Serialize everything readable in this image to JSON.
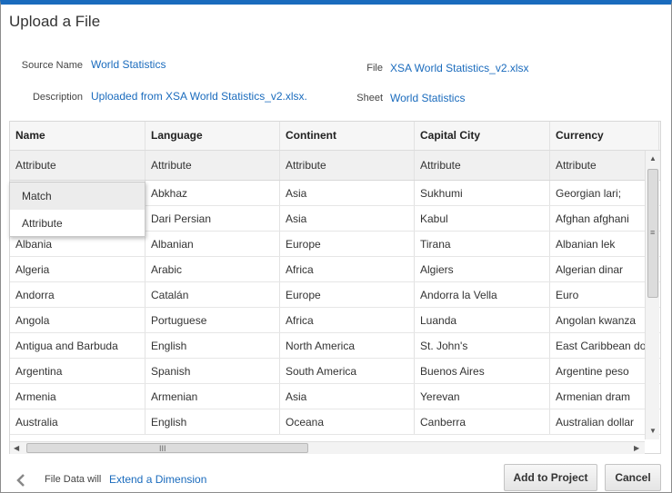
{
  "dialog": {
    "title": "Upload a File"
  },
  "meta": {
    "source_name_label": "Source Name",
    "source_name_value": "World Statistics",
    "description_label": "Description",
    "description_value": "Uploaded from XSA World Statistics_v2.xlsx.",
    "file_label": "File",
    "file_value": "XSA World Statistics_v2.xlsx",
    "sheet_label": "Sheet",
    "sheet_value": "World Statistics"
  },
  "table": {
    "columns": [
      "Name",
      "Language",
      "Continent",
      "Capital City",
      "Currency"
    ],
    "types": [
      "Attribute",
      "Attribute",
      "Attribute",
      "Attribute",
      "Attribute"
    ],
    "rows": [
      [
        "",
        "Abkhaz",
        "Asia",
        "Sukhumi",
        "Georgian lari;"
      ],
      [
        "",
        "Dari Persian",
        "Asia",
        "Kabul",
        "Afghan afghani"
      ],
      [
        "Albania",
        "Albanian",
        "Europe",
        "Tirana",
        "Albanian lek"
      ],
      [
        "Algeria",
        "Arabic",
        "Africa",
        "Algiers",
        "Algerian dinar"
      ],
      [
        "Andorra",
        "Catalán",
        "Europe",
        "Andorra la Vella",
        "Euro"
      ],
      [
        "Angola",
        "Portuguese",
        "Africa",
        "Luanda",
        "Angolan kwanza"
      ],
      [
        "Antigua and Barbuda",
        "English",
        "North America",
        "St. John's",
        "East Caribbean do"
      ],
      [
        "Argentina",
        "Spanish",
        "South America",
        "Buenos Aires",
        "Argentine peso"
      ],
      [
        "Armenia",
        "Armenian",
        "Asia",
        "Yerevan",
        "Armenian dram"
      ],
      [
        "Australia",
        "English",
        "Oceana",
        "Canberra",
        "Australian dollar"
      ]
    ]
  },
  "popup": {
    "items": [
      "Match",
      "Attribute"
    ]
  },
  "scroll": {
    "grip": "III",
    "grip_v": "≡"
  },
  "footer": {
    "text": "File Data will",
    "link": "Extend a Dimension",
    "add_button": "Add to Project",
    "cancel_button": "Cancel"
  },
  "colors": {
    "accent": "#1a6bbd",
    "top_bar": "#1a6bbd"
  },
  "icons": {
    "back": "chevron-left-icon"
  }
}
